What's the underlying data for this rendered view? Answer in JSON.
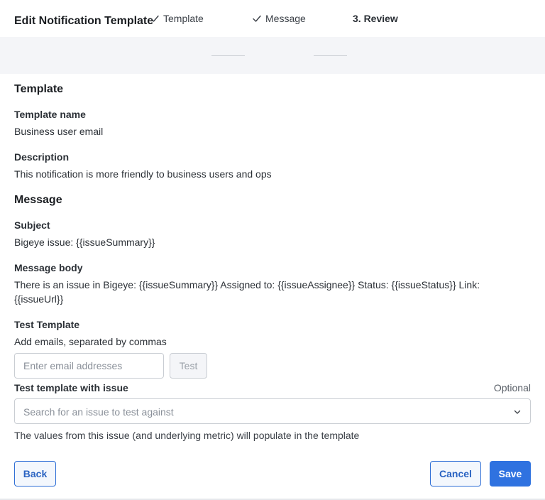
{
  "dialog": {
    "title": "Edit Notification Template"
  },
  "stepper": {
    "steps": [
      {
        "label": "Template",
        "state": "done"
      },
      {
        "label": "Message",
        "state": "done"
      },
      {
        "label": "3. Review",
        "state": "active"
      }
    ]
  },
  "template_section": {
    "heading": "Template",
    "name_label": "Template name",
    "name_value": "Business user email",
    "description_label": "Description",
    "description_value": "This notification is more friendly to business users and ops"
  },
  "message_section": {
    "heading": "Message",
    "subject_label": "Subject",
    "subject_value": "Bigeye issue: {{issueSummary}}",
    "body_label": "Message body",
    "body_value": "There is an issue in Bigeye: {{issueSummary}} Assigned to: {{issueAssignee}} Status: {{issueStatus}} Link: {{issueUrl}}"
  },
  "test_section": {
    "heading": "Test Template",
    "emails_label": "Add emails, separated by commas",
    "emails_placeholder": "Enter email addresses",
    "emails_value": "",
    "test_button": "Test",
    "issue_label": "Test template with issue",
    "issue_optional": "Optional",
    "issue_placeholder": "Search for an issue to test against",
    "issue_hint": "The values from this issue (and underlying metric) will populate in the template"
  },
  "footer": {
    "back": "Back",
    "cancel": "Cancel",
    "save": "Save"
  },
  "colors": {
    "primary": "#2f72e0",
    "stepper_bg": "#f4f5f8",
    "border": "#c9cdd3"
  },
  "icons": {
    "step_done": "check-icon",
    "select": "chevron-down-icon"
  }
}
